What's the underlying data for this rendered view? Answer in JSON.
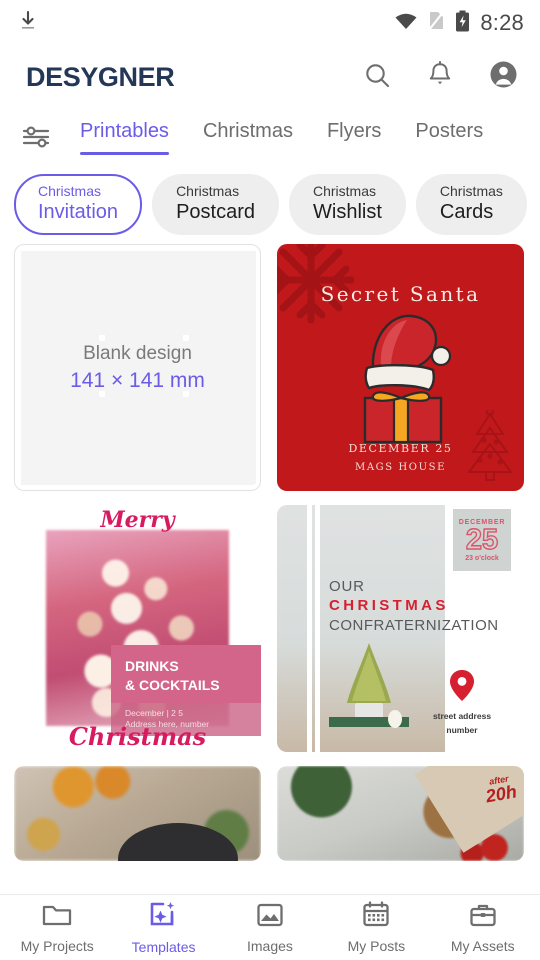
{
  "status_bar": {
    "time": "8:28",
    "icons": [
      "download-icon",
      "wifi-icon",
      "sim-off-icon",
      "battery-charging-icon"
    ]
  },
  "header": {
    "brand": "DESYGNER",
    "brand_color": "#243757",
    "icons": [
      "search-icon",
      "bell-icon",
      "account-avatar-icon"
    ]
  },
  "accent_color": "#6B5CE7",
  "tabs": {
    "filter_icon": "filter-sliders-icon",
    "items": [
      {
        "label": "Printables",
        "active": true
      },
      {
        "label": "Christmas",
        "active": false
      },
      {
        "label": "Flyers",
        "active": false
      },
      {
        "label": "Posters",
        "active": false
      }
    ]
  },
  "chips": [
    {
      "top": "Christmas",
      "main": "Invitation",
      "active": true
    },
    {
      "top": "Christmas",
      "main": "Postcard",
      "active": false
    },
    {
      "top": "Christmas",
      "main": "Wishlist",
      "active": false
    },
    {
      "top": "Christmas",
      "main": "Cards",
      "active": false
    }
  ],
  "templates": {
    "blank": {
      "title": "Blank design",
      "size": "141 × 141 mm"
    },
    "secret_santa": {
      "title": "Secret Santa",
      "date": "DECEMBER 25",
      "location": "MAGS HOUSE",
      "background": "#C1181C"
    },
    "merry_christmas": {
      "top_word": "Merry",
      "bottom_word": "Christmas",
      "band_line1": "DRINKS",
      "band_line2": "& COCKTAILS",
      "detail_line1": "December | 2 5",
      "detail_line2": "Address here, number"
    },
    "confraternization": {
      "line1": "OUR",
      "line2": "CHRISTMAS",
      "line3": "CONFRATERNIZATION",
      "badge_month": "DECEMBER",
      "badge_day": "25",
      "badge_time": "23 o'clock",
      "address_line1": "street address",
      "address_line2": "number",
      "pin_icon": "map-pin-icon"
    },
    "bottom_left": {
      "alt": "christmas-food-template"
    },
    "bottom_right": {
      "after_label": "after",
      "hour_label": "20h"
    }
  },
  "bottom_nav": [
    {
      "label": "My Projects",
      "icon": "folder-icon",
      "active": false
    },
    {
      "label": "Templates",
      "icon": "template-sparkle-icon",
      "active": true
    },
    {
      "label": "Images",
      "icon": "image-icon",
      "active": false
    },
    {
      "label": "My Posts",
      "icon": "calendar-icon",
      "active": false
    },
    {
      "label": "My Assets",
      "icon": "briefcase-icon",
      "active": false
    }
  ]
}
